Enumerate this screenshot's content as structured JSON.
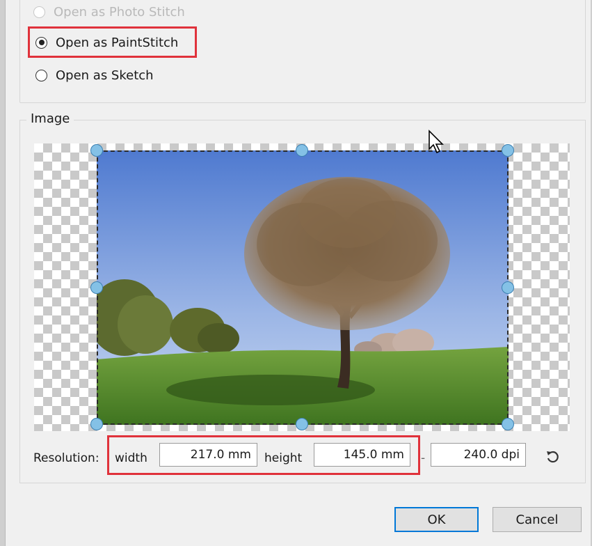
{
  "open_options": {
    "photo_stitch": {
      "label": "Open as Photo Stitch",
      "selected": false
    },
    "paintstitch": {
      "label": "Open as PaintStitch",
      "selected": true
    },
    "sketch": {
      "label": "Open as Sketch",
      "selected": false
    }
  },
  "image_group": {
    "legend": "Image"
  },
  "resolution": {
    "label": "Resolution:",
    "width_label": "width",
    "width_value": "217.0 mm",
    "height_label": "height",
    "height_value": "145.0 mm",
    "separator": "-",
    "dpi_value": "240.0 dpi"
  },
  "buttons": {
    "ok": "OK",
    "cancel": "Cancel"
  },
  "colors": {
    "highlight": "#e0323b",
    "handle": "#84c1e6",
    "default_button_border": "#0078d7"
  },
  "icons": {
    "reset": "reset-icon",
    "cursor": "mouse-pointer-icon"
  }
}
